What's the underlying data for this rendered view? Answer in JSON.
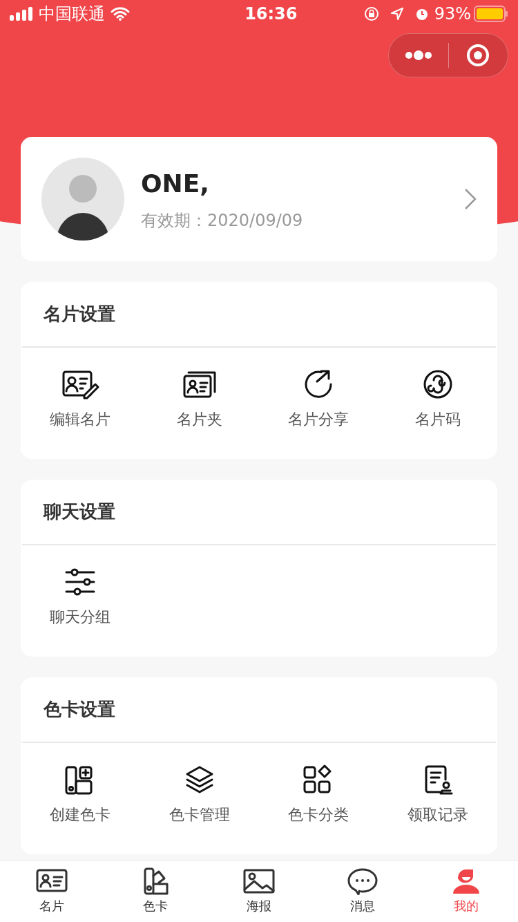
{
  "status_bar": {
    "carrier": "中国联通",
    "time": "16:36",
    "battery": "93%"
  },
  "profile": {
    "name": "ONE,",
    "expiry": "有效期：2020/09/09"
  },
  "sections": [
    {
      "title": "名片设置",
      "items": [
        {
          "label": "编辑名片"
        },
        {
          "label": "名片夹"
        },
        {
          "label": "名片分享"
        },
        {
          "label": "名片码"
        }
      ]
    },
    {
      "title": "聊天设置",
      "items": [
        {
          "label": "聊天分组"
        }
      ]
    },
    {
      "title": "色卡设置",
      "items": [
        {
          "label": "创建色卡"
        },
        {
          "label": "色卡管理"
        },
        {
          "label": "色卡分类"
        },
        {
          "label": "领取记录"
        }
      ]
    }
  ],
  "tab_bar": [
    {
      "label": "名片",
      "selected": false
    },
    {
      "label": "色卡",
      "selected": false
    },
    {
      "label": "海报",
      "selected": false
    },
    {
      "label": "消息",
      "selected": false
    },
    {
      "label": "我的",
      "selected": true
    }
  ]
}
